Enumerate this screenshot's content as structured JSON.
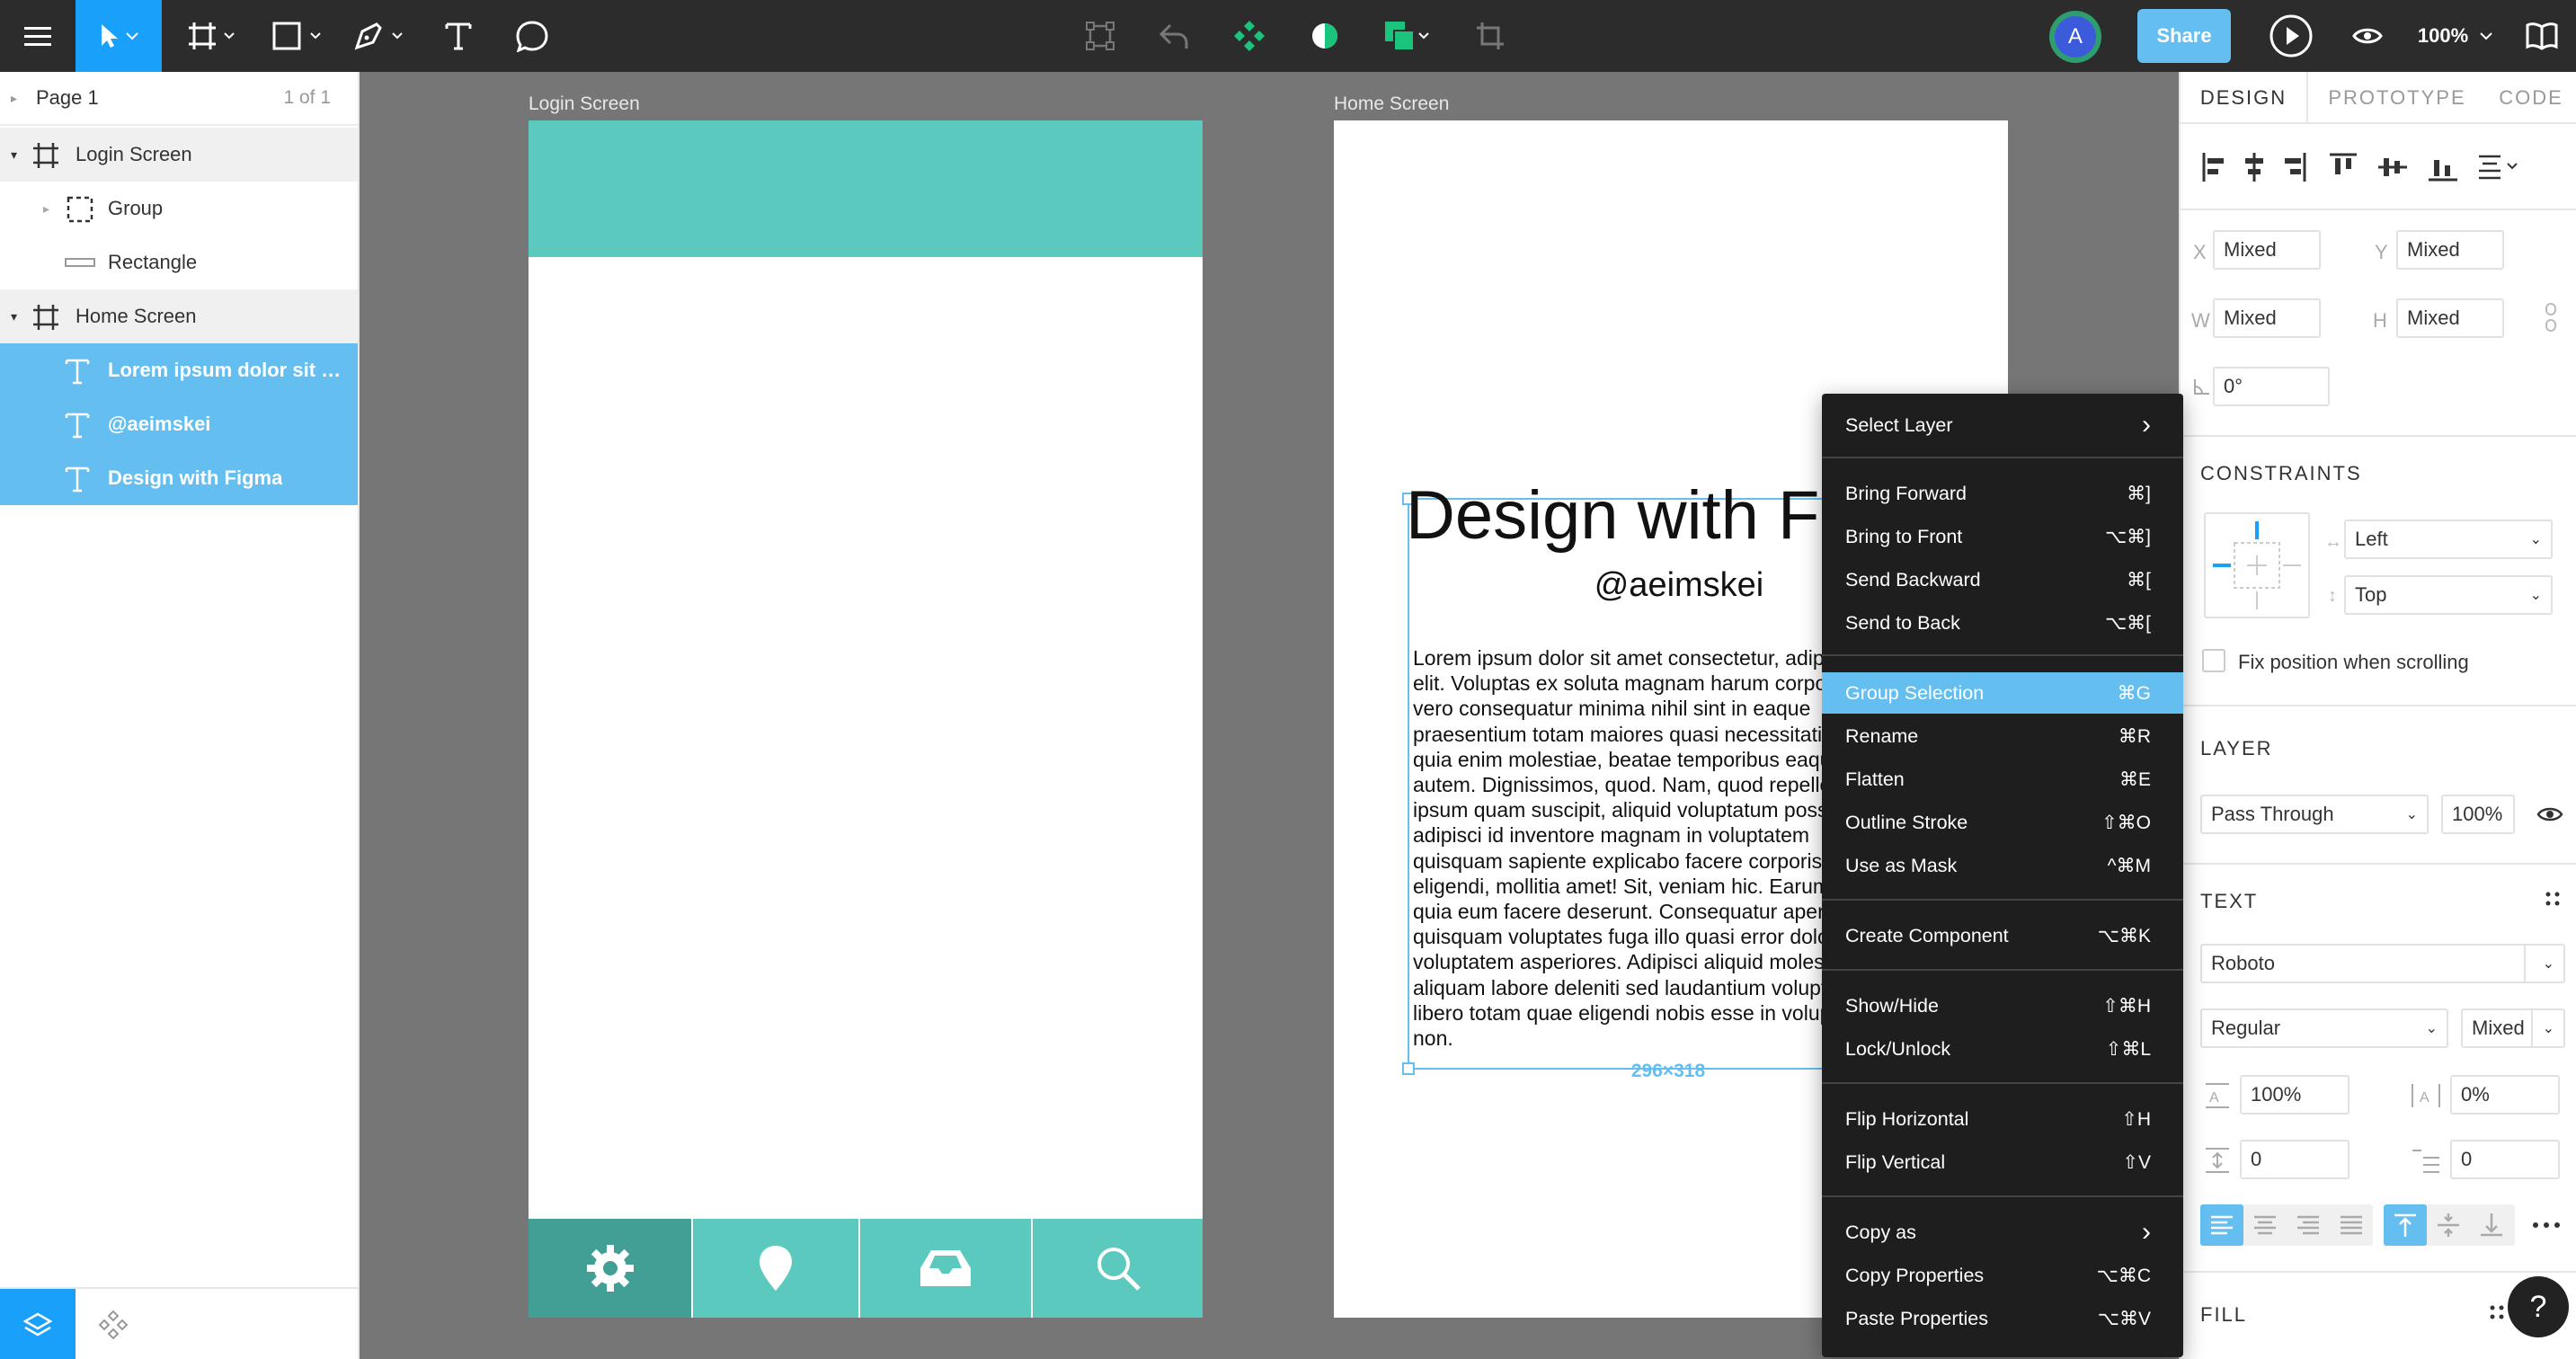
{
  "toolbar": {
    "zoom": "100%",
    "share_label": "Share",
    "avatar_initial": "A"
  },
  "layers_panel": {
    "page_name": "Page 1",
    "page_count": "1 of 1",
    "layers": [
      {
        "label": "Login Screen",
        "type": "frame"
      },
      {
        "label": "Group",
        "type": "group"
      },
      {
        "label": "Rectangle",
        "type": "rectangle"
      },
      {
        "label": "Home Screen",
        "type": "frame"
      },
      {
        "label": "Lorem ipsum dolor sit am...",
        "type": "text",
        "selected": true
      },
      {
        "label": "@aeimskei",
        "type": "text",
        "selected": true
      },
      {
        "label": "Design with Figma",
        "type": "text",
        "selected": true
      }
    ]
  },
  "canvas": {
    "login_title": "Login Screen",
    "home_title": "Home Screen",
    "accent_color": "#5cc9bf",
    "heading": "Design with Figma",
    "handle": "@aeimskei",
    "body_lines": [
      "Lorem ipsum dolor sit amet consectetur, adipisicing",
      "elit. Voluptas ex soluta magnam harum corporis",
      "vero consequatur minima nihil sint in eaque",
      "praesentium totam maiores quasi necessitatibus",
      "quia enim molestiae, beatae temporibus eaque",
      "autem. Dignissimos, quod. Nam, quod repellendus",
      "ipsum quam suscipit, aliquid voluptatum possimus",
      "adipisci id inventore magnam in voluptatem",
      "quisquam sapiente explicabo facere corporis",
      "eligendi, mollitia amet! Sit, veniam hic. Earum",
      "quia eum facere deserunt. Consequatur aperiam",
      "quisquam voluptates fuga illo quasi error dolor",
      "voluptatem asperiores. Adipisci aliquid molestias",
      "aliquam labore deleniti sed laudantium voluptas",
      "libero totam quae eligendi nobis esse in voluptas",
      "non."
    ],
    "selection_size": "296×318"
  },
  "context_menu": {
    "items": [
      {
        "label": "Select Layer",
        "shortcut": "›"
      },
      {
        "label": "Bring Forward",
        "shortcut": "⌘]"
      },
      {
        "label": "Bring to Front",
        "shortcut": "⌥⌘]"
      },
      {
        "label": "Send Backward",
        "shortcut": "⌘["
      },
      {
        "label": "Send to Back",
        "shortcut": "⌥⌘["
      },
      {
        "label": "Group Selection",
        "shortcut": "⌘G"
      },
      {
        "label": "Rename",
        "shortcut": "⌘R"
      },
      {
        "label": "Flatten",
        "shortcut": "⌘E"
      },
      {
        "label": "Outline Stroke",
        "shortcut": "⇧⌘O"
      },
      {
        "label": "Use as Mask",
        "shortcut": "^⌘M"
      },
      {
        "label": "Create Component",
        "shortcut": "⌥⌘K"
      },
      {
        "label": "Show/Hide",
        "shortcut": "⇧⌘H"
      },
      {
        "label": "Lock/Unlock",
        "shortcut": "⇧⌘L"
      },
      {
        "label": "Flip Horizontal",
        "shortcut": "⇧H"
      },
      {
        "label": "Flip Vertical",
        "shortcut": "⇧V"
      },
      {
        "label": "Copy as",
        "shortcut": "›"
      },
      {
        "label": "Copy Properties",
        "shortcut": "⌥⌘C"
      },
      {
        "label": "Paste Properties",
        "shortcut": "⌥⌘V"
      }
    ]
  },
  "properties": {
    "tabs": [
      "DESIGN",
      "PROTOTYPE",
      "CODE"
    ],
    "x_label": "X",
    "x": "Mixed",
    "y_label": "Y",
    "y": "Mixed",
    "w_label": "W",
    "w": "Mixed",
    "h_label": "H",
    "h": "Mixed",
    "rotation": "0°",
    "constraints_title": "CONSTRAINTS",
    "constraint_h": "Left",
    "constraint_v": "Top",
    "fix_scroll": "Fix position when scrolling",
    "layer_title": "LAYER",
    "blend": "Pass Through",
    "opacity": "100%",
    "text_title": "TEXT",
    "font": "Roboto",
    "weight": "Regular",
    "size": "Mixed",
    "line_height": "100%",
    "letter_spacing": "0%",
    "paragraph_spacing": "0",
    "paragraph_indent": "0",
    "fill_title": "FILL",
    "help": "?"
  }
}
